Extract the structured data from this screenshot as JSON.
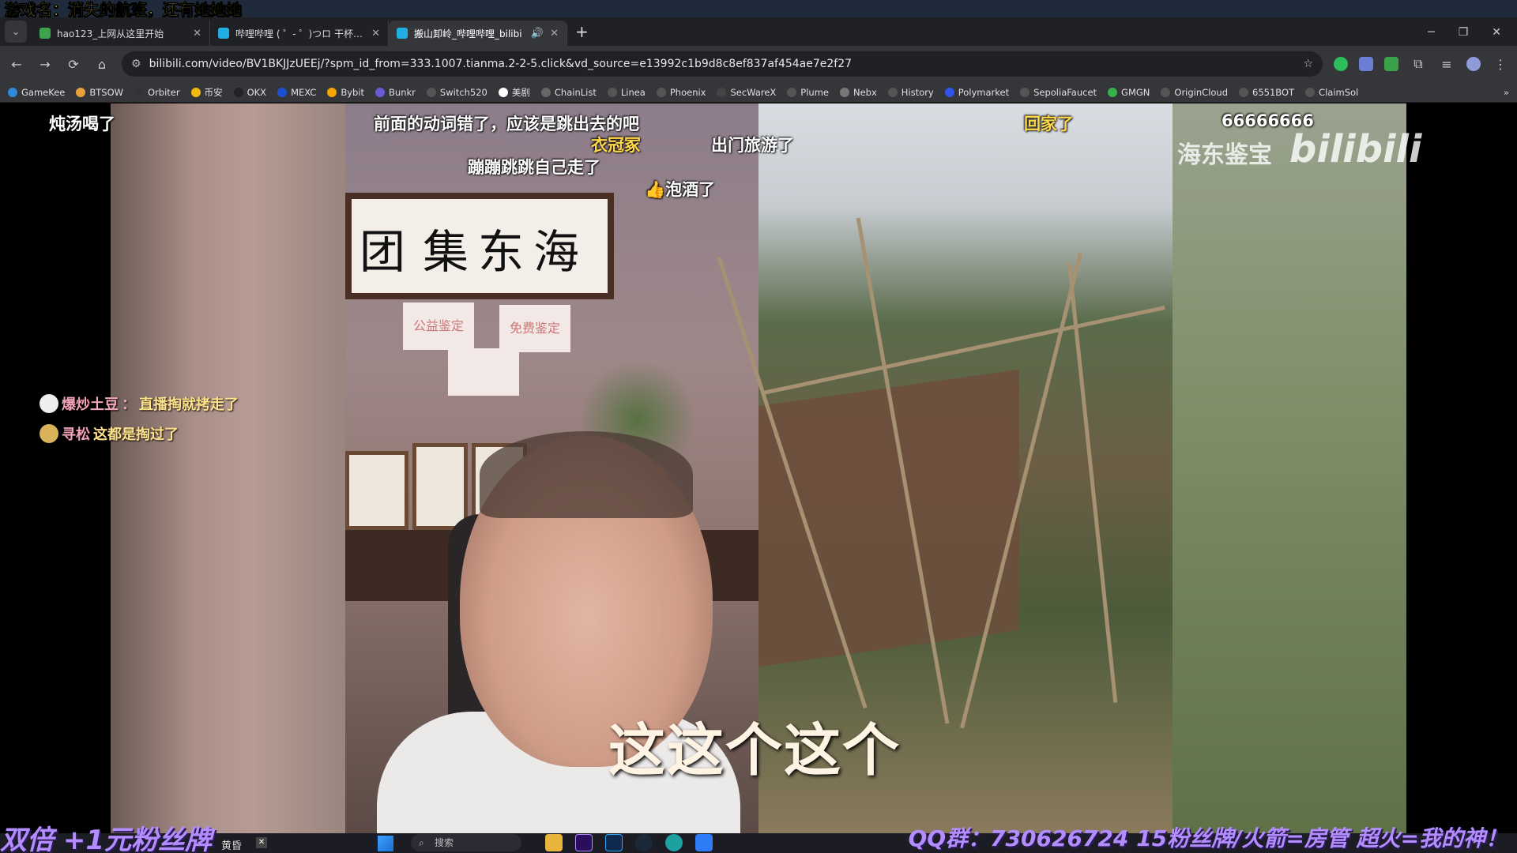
{
  "overlay": {
    "title": "游戏名：消失的航班，还有她她她",
    "promo": "双倍 +1元粉丝牌",
    "bottom_right": "QQ群：730626724 15粉丝牌/火箭=房管 超火=我的神！"
  },
  "browser": {
    "tabs": [
      {
        "label": "hao123_上网从这里开始",
        "color": "#3fa34d"
      },
      {
        "label": "哔哩哔哩 ( ゜- ゜)つロ 干杯~-bi",
        "color": "#23ade5"
      },
      {
        "label": "搬山卸岭_哔哩哔哩_bilibi",
        "color": "#23ade5"
      }
    ],
    "url": "bilibili.com/video/BV1BKJJzUEEj/?spm_id_from=333.1007.tianma.2-2-5.click&vd_source=e13992c1b9d8c8ef837af454ae7e2f27",
    "bookmarks": [
      "GameKee",
      "BTSOW",
      "Orbiter",
      "币安",
      "OKX",
      "MEXC",
      "Bybit",
      "Bunkr",
      "Switch520",
      "美剧",
      "ChainList",
      "Linea",
      "Phoenix",
      "SecWareX",
      "Plume",
      "Nebx",
      "History",
      "Polymarket",
      "SepoliaFaucet",
      "GMGN",
      "OriginCloud",
      "6551BOT",
      "ClaimSol"
    ],
    "bookmark_more": "»",
    "new_tab": "+",
    "menu": "⌄"
  },
  "danmaku": {
    "d1": "炖汤喝了",
    "d2": "前面的动词错了，应该是跳出去的吧",
    "d3": "衣冠冢",
    "d4": "出门旅游了",
    "d5": "蹦蹦跳跳自己走了",
    "d6": "👍泡酒了",
    "d7": "回家了",
    "d8": "66666666"
  },
  "chat": [
    {
      "user": "爆炒土豆",
      "sep": "：",
      "msg": "直播掏就拷走了"
    },
    {
      "user": "寻松",
      "sep": "",
      "msg": "这都是掏过了"
    }
  ],
  "video": {
    "watermark_text": "海东鉴宝",
    "watermark_logo": "bilibili",
    "subtitle": "这这个这个",
    "calligraphy": [
      "海",
      "东",
      "集",
      "团"
    ],
    "notes": [
      "公益鉴定",
      "免费鉴定"
    ]
  },
  "taskbar": {
    "weather": "黄昏",
    "search_placeholder": "搜索"
  }
}
